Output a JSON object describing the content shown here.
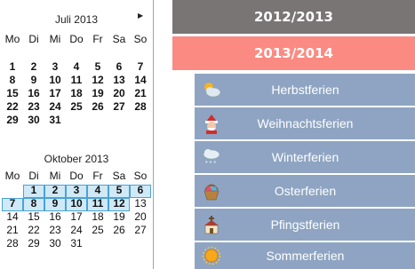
{
  "calendar": {
    "weekday_labels": [
      "Mo",
      "Di",
      "Mi",
      "Do",
      "Fr",
      "Sa",
      "So"
    ],
    "month1": {
      "title": "Juli 2013",
      "weeks": [
        [
          "1",
          "2",
          "3",
          "4",
          "5",
          "6",
          "7"
        ],
        [
          "8",
          "9",
          "10",
          "11",
          "12",
          "13",
          "14"
        ],
        [
          "15",
          "16",
          "17",
          "18",
          "19",
          "20",
          "21"
        ],
        [
          "22",
          "23",
          "24",
          "25",
          "26",
          "27",
          "28"
        ],
        [
          "29",
          "30",
          "31",
          "",
          "",
          "",
          ""
        ]
      ]
    },
    "month2": {
      "title": "Oktober 2013",
      "weeks": [
        [
          "",
          "1",
          "2",
          "3",
          "4",
          "5",
          "6"
        ],
        [
          "7",
          "8",
          "9",
          "10",
          "11",
          "12",
          "13"
        ],
        [
          "14",
          "15",
          "16",
          "17",
          "18",
          "19",
          "20"
        ],
        [
          "21",
          "22",
          "23",
          "24",
          "25",
          "26",
          "27"
        ],
        [
          "28",
          "29",
          "30",
          "31",
          "",
          "",
          ""
        ]
      ],
      "selected_days": [
        "1",
        "2",
        "3",
        "4",
        "5",
        "6",
        "7",
        "8",
        "9",
        "10",
        "11",
        "12"
      ]
    }
  },
  "years": [
    {
      "label": "2012/2013",
      "color": "#7a7575"
    },
    {
      "label": "2013/2014",
      "color": "#fb8b82"
    }
  ],
  "holidays": [
    {
      "label": "Herbstferien",
      "icon": "cloud-sun-icon"
    },
    {
      "label": "Weihnachtsferien",
      "icon": "santa-icon"
    },
    {
      "label": "Winterferien",
      "icon": "snow-cloud-icon"
    },
    {
      "label": "Osterferien",
      "icon": "easter-basket-icon"
    },
    {
      "label": "Pfingstferien",
      "icon": "church-icon"
    },
    {
      "label": "Sommerferien",
      "icon": "sun-icon"
    }
  ]
}
